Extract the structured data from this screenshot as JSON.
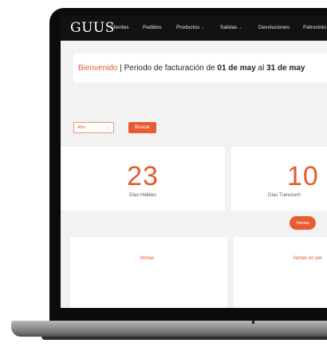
{
  "navbar": {
    "logo": "GUUS",
    "items": [
      {
        "label": "Clientes"
      },
      {
        "label": "Pedidos"
      },
      {
        "label": "Productos"
      },
      {
        "label": "Salidas"
      },
      {
        "label": "Devoluciones"
      },
      {
        "label": "Patrocinio"
      }
    ]
  },
  "welcome": {
    "greeting": "Bienvenido",
    "separator": "| Periodo de facturación de ",
    "start": "01 de may",
    "connector": " al ",
    "end": "31 de may"
  },
  "filters": {
    "year_placeholder": "Año",
    "search_label": "Buscar"
  },
  "stats": {
    "business_days": {
      "value": "23",
      "label": "Días Hábiles"
    },
    "elapsed_days": {
      "value": "10",
      "label": "Días Transcurri"
    }
  },
  "actions": {
    "sales_button": "Ventas"
  },
  "panels": {
    "sales_title": "Ventas",
    "sales_by_title": "Ventas en per"
  },
  "colors": {
    "accent": "#e65a2e",
    "navbar_bg": "#121212",
    "page_bg": "#f2f2f2"
  }
}
